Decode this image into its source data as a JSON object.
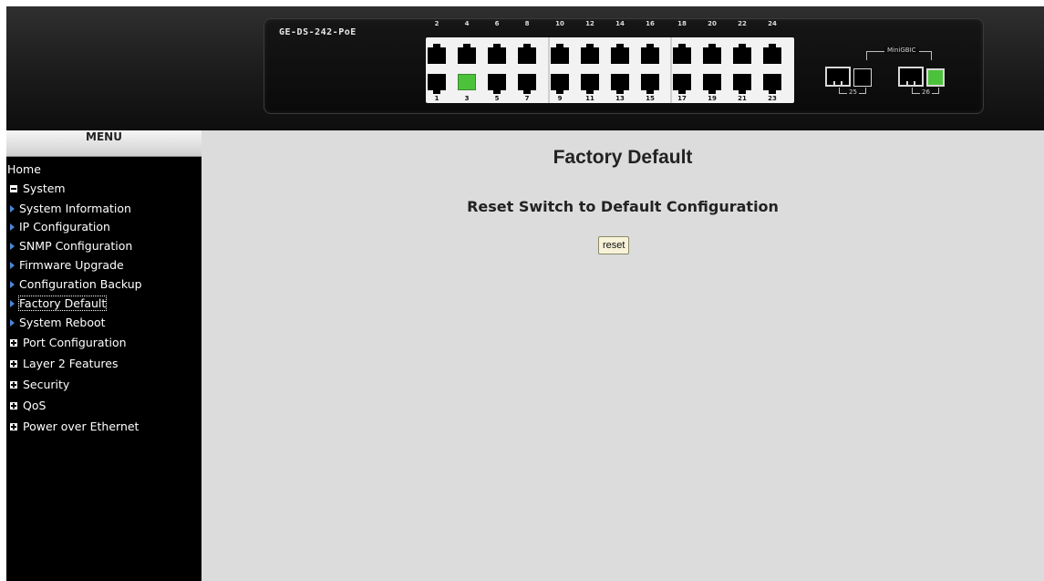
{
  "header": {
    "model": "GE-DS-242-PoE",
    "top_port_numbers": [
      "2",
      "4",
      "6",
      "8",
      "10",
      "12",
      "14",
      "16",
      "18",
      "20",
      "22",
      "24"
    ],
    "bottom_port_numbers": [
      "1",
      "3",
      "5",
      "7",
      "9",
      "11",
      "13",
      "15",
      "17",
      "19",
      "21",
      "23"
    ],
    "active_port": "3",
    "minigbic_label": "MiniGBIC",
    "sfp_ports": [
      "25",
      "26"
    ],
    "active_sfp": "26",
    "colors": {
      "active_link": "#4cc23a",
      "port_block": "#f2f2f2",
      "panel": "#111111"
    }
  },
  "menu": {
    "title": "MENU",
    "home": "Home",
    "system": "System",
    "system_items": [
      "System Information",
      "IP Configuration",
      "SNMP Configuration",
      "Firmware Upgrade",
      "Configuration Backup",
      "Factory Default",
      "System Reboot"
    ],
    "current_item": "Factory Default",
    "groups": [
      "Port Configuration",
      "Layer 2 Features",
      "Security",
      "QoS",
      "Power over Ethernet"
    ],
    "icons": {
      "expanded": "minus-box-icon",
      "collapsed": "plus-box-icon",
      "item": "blue-triangle-icon"
    }
  },
  "main": {
    "title": "Factory Default",
    "subtitle": "Reset Switch to Default Configuration",
    "reset_label": "reset"
  }
}
